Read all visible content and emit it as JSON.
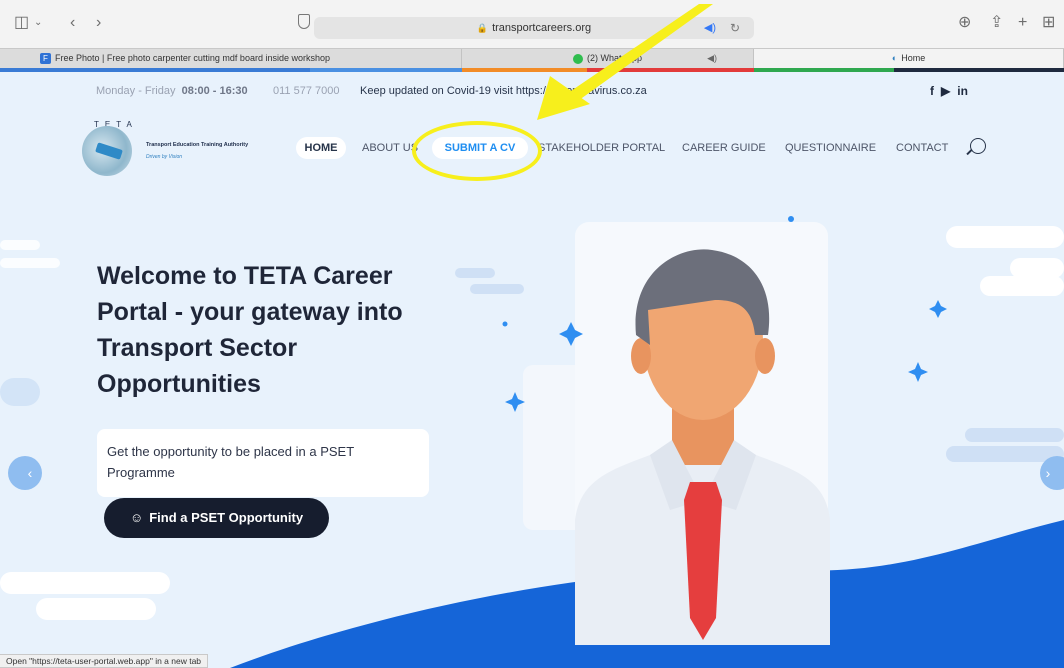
{
  "browser": {
    "url": "transportcareers.org",
    "tabs": [
      {
        "label": "Free Photo | Free photo carpenter cutting mdf board inside workshop"
      },
      {
        "label": "(2) WhatsApp"
      },
      {
        "label": "Home"
      }
    ],
    "status_text": "Open \"https://teta-user-portal.web.app\" in a new tab"
  },
  "topbar": {
    "days": "Monday - Friday",
    "time": "08:00 - 16:30",
    "phone": "011 577 7000",
    "covid": "Keep updated on Covid-19 visit https://sacoronavirus.co.za",
    "social": [
      "f",
      "▶",
      "in"
    ]
  },
  "logo": {
    "letters": "TETA",
    "name": "Transport Education Training Authority",
    "slogan": "Driven by Vision"
  },
  "nav": {
    "home": "HOME",
    "about": "ABOUT US",
    "submit_cv": "SUBMIT A CV",
    "stakeholder": "STAKEHOLDER PORTAL",
    "career_guide": "CAREER GUIDE",
    "questionnaire": "QUESTIONNAIRE",
    "contact": "CONTACT"
  },
  "hero": {
    "title": "Welcome to TETA Career Portal - your gateway into Transport Sector Opportunities",
    "card_text": "Get the opportunity to be placed in a PSET Programme",
    "button": "Find a PSET Opportunity"
  },
  "colors": {
    "accent": "#1f8ef1",
    "dark": "#161d2e",
    "annotation": "#f7ef1c",
    "background": "#e8f2fc"
  }
}
